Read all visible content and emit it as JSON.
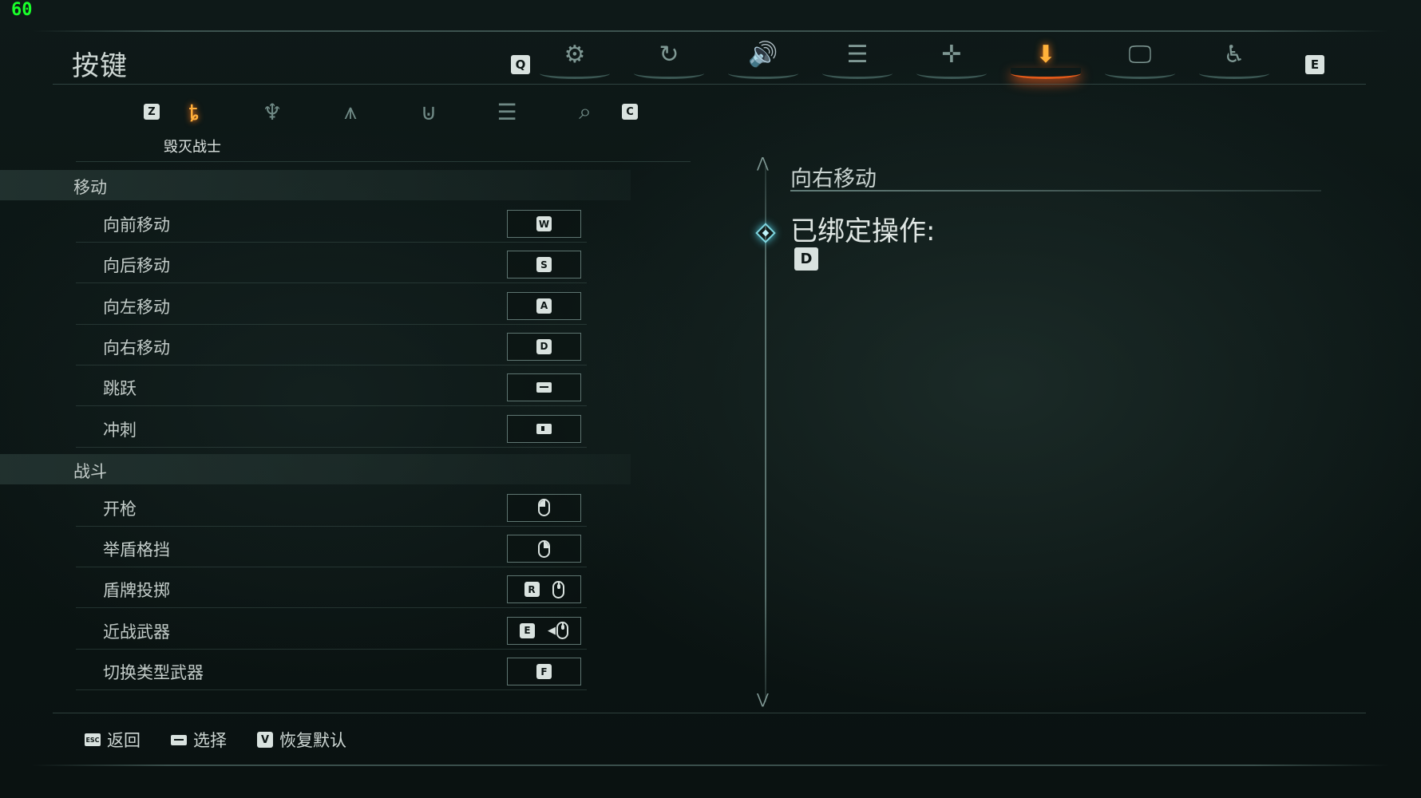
{
  "fps": "60",
  "page_title": "按键",
  "top_tabs": {
    "prev_key": "Q",
    "next_key": "E",
    "items": [
      {
        "icon": "gear-icon",
        "glyph": "⚙"
      },
      {
        "icon": "swirl-icon",
        "glyph": "↻"
      },
      {
        "icon": "speaker-icon",
        "glyph": "🔊"
      },
      {
        "icon": "list-icon",
        "glyph": "☰"
      },
      {
        "icon": "crosshair-icon",
        "glyph": "✛"
      },
      {
        "icon": "controls-icon",
        "glyph": "⬇"
      },
      {
        "icon": "monitor-icon",
        "glyph": "🖵"
      },
      {
        "icon": "accessibility-icon",
        "glyph": "♿"
      }
    ],
    "active_index": 5
  },
  "sub_tabs": {
    "prev_key": "Z",
    "next_key": "C",
    "items": [
      {
        "icon": "slayer-icon",
        "glyph": "ȶ"
      },
      {
        "icon": "demon-mask-icon",
        "glyph": "♆"
      },
      {
        "icon": "wings-icon",
        "glyph": "⩚"
      },
      {
        "icon": "shield-emblem-icon",
        "glyph": "⊍"
      },
      {
        "icon": "list-icon",
        "glyph": "☰"
      },
      {
        "icon": "magnifier-eye-icon",
        "glyph": "⌕"
      }
    ],
    "active_label": "毁灭战士"
  },
  "sections": [
    {
      "title": "移动",
      "rows": [
        {
          "label": "向前移动",
          "keys": [
            "W"
          ]
        },
        {
          "label": "向后移动",
          "keys": [
            "S"
          ]
        },
        {
          "label": "向左移动",
          "keys": [
            "A"
          ]
        },
        {
          "label": "向右移动",
          "keys": [
            "D"
          ]
        },
        {
          "label": "跳跃",
          "keys": [
            "space-key"
          ]
        },
        {
          "label": "冲刺",
          "keys": [
            "shift-key"
          ]
        }
      ]
    },
    {
      "title": "战斗",
      "rows": [
        {
          "label": "开枪",
          "keys": [
            "mouse-left"
          ]
        },
        {
          "label": "举盾格挡",
          "keys": [
            "mouse-right"
          ]
        },
        {
          "label": "盾牌投掷",
          "keys": [
            "R",
            "mouse-middle"
          ]
        },
        {
          "label": "近战武器",
          "keys": [
            "E",
            "mouse-wheel"
          ]
        },
        {
          "label": "切换类型武器",
          "keys": [
            "F"
          ]
        }
      ]
    }
  ],
  "detail": {
    "title": "向右移动",
    "bound_label": "已绑定操作:",
    "bound_key": "D"
  },
  "footer": {
    "back": {
      "key": "ESC",
      "label": "返回"
    },
    "select": {
      "key": "space",
      "label": "选择"
    },
    "reset": {
      "key": "V",
      "label": "恢复默认"
    }
  }
}
